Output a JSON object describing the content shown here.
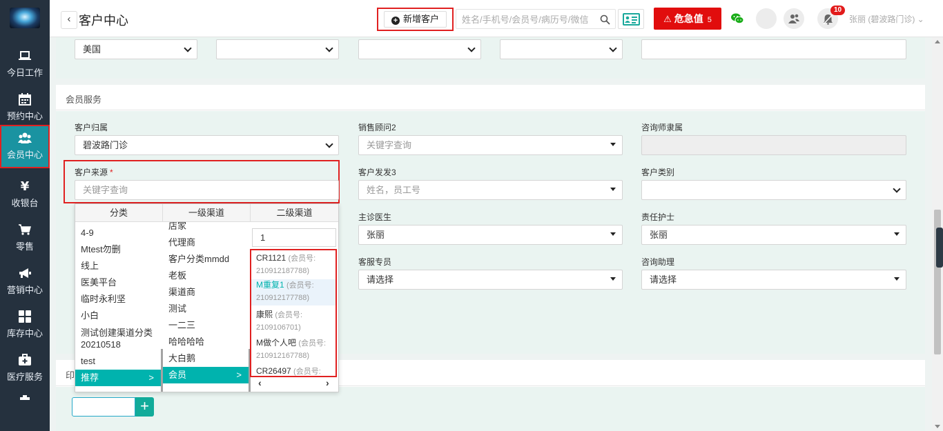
{
  "sidebar": {
    "items": [
      {
        "label": "今日工作",
        "icon": "laptop-icon"
      },
      {
        "label": "预约中心",
        "icon": "calendar-icon"
      },
      {
        "label": "会员中心",
        "icon": "users-icon"
      },
      {
        "label": "收银台",
        "icon": "yen-icon"
      },
      {
        "label": "零售",
        "icon": "cart-icon"
      },
      {
        "label": "营销中心",
        "icon": "megaphone-icon"
      },
      {
        "label": "库存中心",
        "icon": "grid-icon"
      },
      {
        "label": "医疗服务",
        "icon": "medkit-icon"
      }
    ],
    "active_index": 2
  },
  "header": {
    "title": "客户中心",
    "add_customer_label": "新增客户",
    "search_placeholder": "姓名/手机号/会员号/病历号/微信",
    "danger_label": "危急值",
    "danger_count": "5",
    "bell_count": "10",
    "user_name": "张丽 (碧波路门诊)",
    "accent": "#1a93a1",
    "danger_color": "#e10d0d"
  },
  "top_row": {
    "country_value": "美国"
  },
  "member_service": {
    "title": "会员服务",
    "fields": {
      "customer_belong": {
        "label": "客户归属",
        "value": "碧波路门诊"
      },
      "sales_advisor": {
        "label": "销售顾问2",
        "placeholder": "关键字查询"
      },
      "consultant": {
        "label": "咨询师隶属",
        "value": ""
      },
      "customer_source": {
        "label": "客户来源",
        "required": "*",
        "placeholder": "关键字查询"
      },
      "customer_dev": {
        "label": "客户发发3",
        "placeholder": "姓名，员工号"
      },
      "customer_type": {
        "label": "客户类别",
        "value": ""
      },
      "doctor": {
        "label": "主诊医生",
        "value": "张丽"
      },
      "nurse": {
        "label": "责任护士",
        "value": "张丽"
      },
      "service_staff": {
        "label": "客服专员",
        "value": "请选择"
      },
      "consult_assistant": {
        "label": "咨询助理",
        "value": "请选择"
      }
    }
  },
  "cascader": {
    "headers": [
      "分类",
      "一级渠道",
      "二级渠道"
    ],
    "categories": [
      "4-9",
      "Mtest勿删",
      "线上",
      "医美平台",
      "临时永利坚",
      "小白",
      "测试创建渠道分类20210518",
      "test",
      "推荐"
    ],
    "selected_category": "推荐",
    "channels": [
      "店家",
      "代理商",
      "客户分类mmdd",
      "老板",
      "渠道商",
      "测试",
      "一二三",
      "哈哈哈哈",
      "大白鹅",
      "会员"
    ],
    "selected_channel": "会员",
    "search_value": "1",
    "members": [
      {
        "name": "CR1121",
        "no": "(会员号: 210912187788)"
      },
      {
        "name": "M重复1",
        "no": "(会员号: 210912177788)"
      },
      {
        "name": "康熙",
        "no": "(会员号: 2109106701)"
      },
      {
        "name": "M做个人吧",
        "no": "(会员号: 210912167788)"
      },
      {
        "name": "CR26497",
        "no": "(会员号:"
      }
    ],
    "pager_prev": "‹",
    "pager_next": "›"
  },
  "print_section": {
    "title": "印",
    "add_label": "+"
  }
}
